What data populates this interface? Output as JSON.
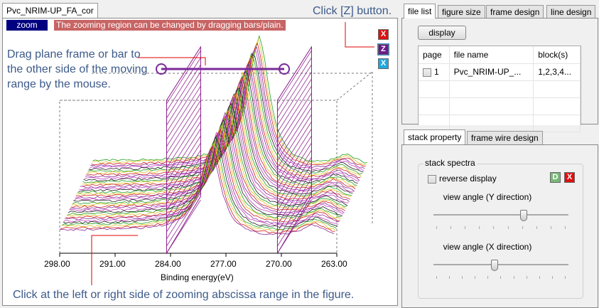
{
  "left": {
    "tab": "Pvc_NRIM-UP_FA_cor",
    "zoom_badge": "zoom",
    "zoom_hint": "The zooming region can be changed by dragging bars/plain.",
    "notes": {
      "click_z": "Click [Z] button.",
      "drag": [
        "Drag plane frame or bar to",
        "the other side of the moving",
        "range by the mouse."
      ],
      "click_side": "Click at the left  or right side of zooming abscissa range in the figure."
    },
    "buttons": {
      "x": "X",
      "z": "Z",
      "x2": "X"
    }
  },
  "chart_data": {
    "type": "stacked-line",
    "xlabel": "Binding energy(eV)",
    "x_ticks": [
      "298.00",
      "291.00",
      "284.00",
      "277.00",
      "270.00",
      "263.00"
    ],
    "xlim": [
      298,
      263
    ],
    "zoom_range": [
      284.5,
      270.5
    ],
    "peak_energy": 279
  },
  "file_panel": {
    "tabs": [
      "file list",
      "figure size",
      "frame design",
      "line design"
    ],
    "display_button": "display",
    "columns": [
      "page",
      "file name",
      "block(s)"
    ],
    "rows": [
      {
        "page": "1",
        "file": "Pvc_NRIM-UP_...",
        "blocks": "1,2,3,4..."
      }
    ]
  },
  "stack_panel": {
    "tabs": [
      "stack property",
      "frame wire design"
    ],
    "group": "stack spectra",
    "reverse_display": "reverse display",
    "d_button": "D",
    "x_button": "X",
    "slider_y_label": "view angle (Y direction)",
    "slider_y_value": 0.68,
    "slider_x_label": "view angle (X direction)",
    "slider_x_value": 0.45
  },
  "colors": {
    "accent": "#7a2a9a",
    "hint_bg": "#c86464",
    "zoom_bg": "#000080",
    "note": "#3d5a8a"
  }
}
